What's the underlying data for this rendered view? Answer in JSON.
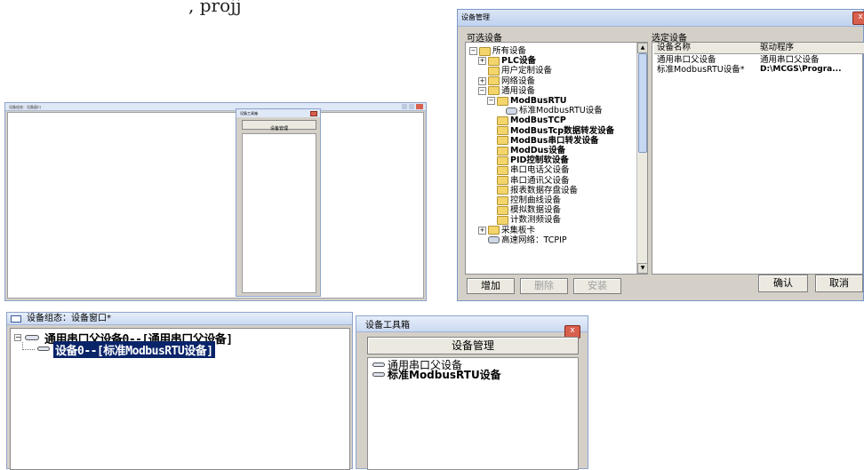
{
  "top_fragment": ", projj",
  "small_main": {
    "title": "设备组态：设备窗口",
    "toolbox_title": "设备工具箱",
    "toolbox_button": "设备管理",
    "close_glyph": "x"
  },
  "dialog": {
    "title": "设备管理",
    "available_label": "可选设备",
    "selected_label": "选定设备",
    "tree": [
      {
        "label": "所有设备",
        "level": 0,
        "icon": "folder",
        "exp": "−",
        "bold": false
      },
      {
        "label": "PLC设备",
        "level": 1,
        "icon": "folder",
        "exp": "+",
        "bold": true
      },
      {
        "label": "用户定制设备",
        "level": 1,
        "icon": "folder",
        "exp": "",
        "bold": false
      },
      {
        "label": "网络设备",
        "level": 1,
        "icon": "folder",
        "exp": "+",
        "bold": false
      },
      {
        "label": "通用设备",
        "level": 1,
        "icon": "folder",
        "exp": "−",
        "bold": false
      },
      {
        "label": "ModBusRTU",
        "level": 2,
        "icon": "folder",
        "exp": "−",
        "bold": true
      },
      {
        "label": "标准ModbusRTU设备",
        "level": 3,
        "icon": "device",
        "exp": "",
        "bold": false
      },
      {
        "label": "ModBusTCP",
        "level": 2,
        "icon": "folder",
        "exp": "",
        "bold": true
      },
      {
        "label": "ModBusTcp数据转发设备",
        "level": 2,
        "icon": "folder",
        "exp": "",
        "bold": true
      },
      {
        "label": "ModBus串口转发设备",
        "level": 2,
        "icon": "folder",
        "exp": "",
        "bold": true
      },
      {
        "label": "ModDus设备",
        "level": 2,
        "icon": "folder",
        "exp": "",
        "bold": true
      },
      {
        "label": "PID控制软设备",
        "level": 2,
        "icon": "folder",
        "exp": "",
        "bold": true
      },
      {
        "label": "串口电话父设备",
        "level": 2,
        "icon": "folder",
        "exp": "",
        "bold": false
      },
      {
        "label": "串口通讯父设备",
        "level": 2,
        "icon": "folder",
        "exp": "",
        "bold": false
      },
      {
        "label": "报表数据存盘设备",
        "level": 2,
        "icon": "folder",
        "exp": "",
        "bold": false
      },
      {
        "label": "控制曲线设备",
        "level": 2,
        "icon": "folder",
        "exp": "",
        "bold": false
      },
      {
        "label": "模拟数据设备",
        "level": 2,
        "icon": "folder",
        "exp": "",
        "bold": false
      },
      {
        "label": "计数测频设备",
        "level": 2,
        "icon": "folder",
        "exp": "",
        "bold": false
      },
      {
        "label": "采集板卡",
        "level": 1,
        "icon": "folder",
        "exp": "+",
        "bold": false
      },
      {
        "label": "高速网络：TCPIP",
        "level": 1,
        "icon": "device",
        "exp": "",
        "bold": false
      }
    ],
    "columns": [
      "设备名称",
      "驱动程序"
    ],
    "rows": [
      [
        "通用串口父设备",
        "通用串口父设备"
      ],
      [
        "标准ModbusRTU设备*",
        "D:\\MCGS\\Progra..."
      ]
    ],
    "buttons": {
      "add": "增加",
      "delete": "删除",
      "install": "安装",
      "ok": "确认",
      "cancel": "取消"
    },
    "close_glyph": "x"
  },
  "main_window": {
    "title": "设备组态：设备窗口*",
    "tree_root": "通用串口父设备0--[通用串口父设备]",
    "tree_child": "设备0--[标准ModbusRTU设备]"
  },
  "toolbox": {
    "title": "设备工具箱",
    "button": "设备管理",
    "items": [
      "通用串口父设备",
      "标准ModbusRTU设备"
    ],
    "close_glyph": "x"
  },
  "colors": {
    "selection": "#0a246a",
    "title_bar": "#c0d2ee",
    "folder": "#f3d56b",
    "close": "#d8604e"
  }
}
